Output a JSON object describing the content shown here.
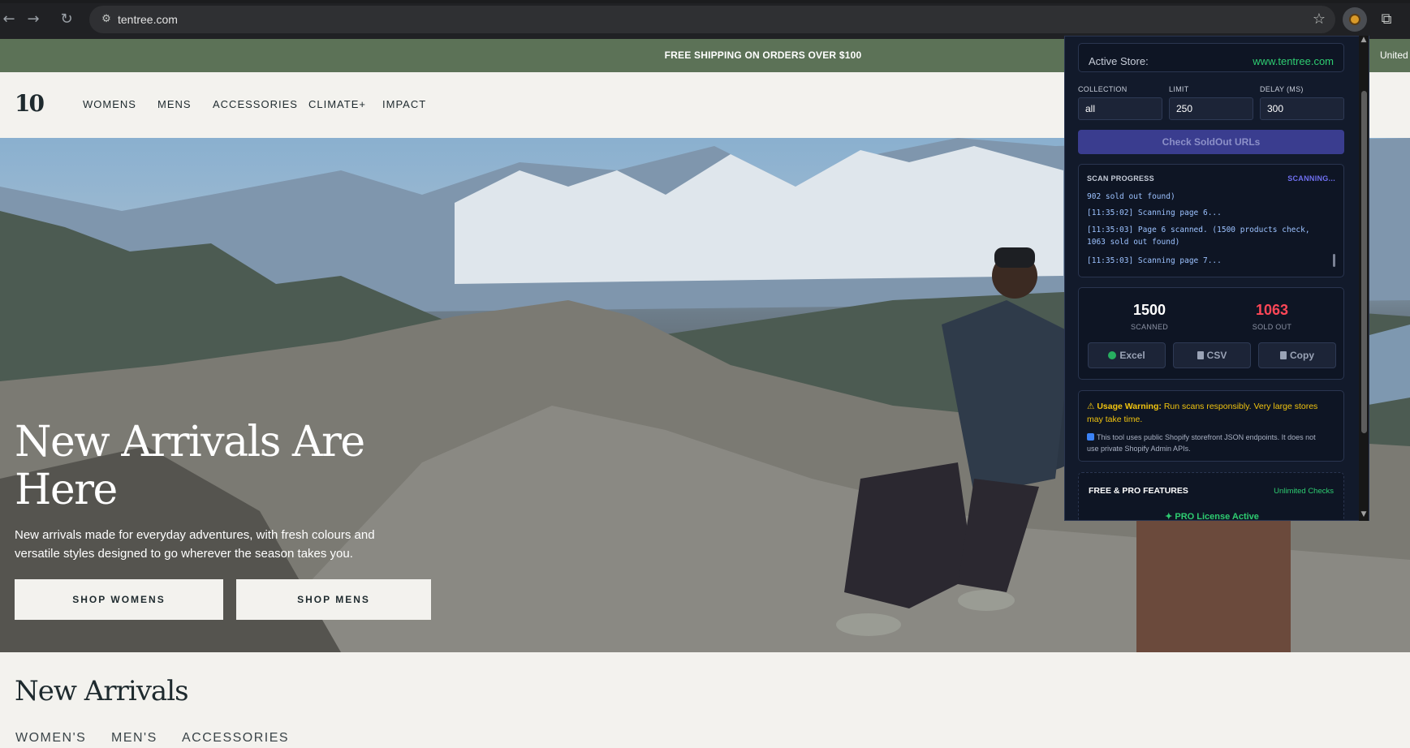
{
  "browser": {
    "url": "tentree.com"
  },
  "site": {
    "announcement": "FREE SHIPPING ON ORDERS OVER $100",
    "country": "United",
    "logo": "10",
    "nav": [
      "WOMENS",
      "MENS",
      "ACCESSORIES",
      "CLIMATE+",
      "IMPACT"
    ],
    "hero": {
      "title": "New Arrivals Are Here",
      "subtitle": "New arrivals made for everyday adventures, with fresh colours and versatile styles designed to go wherever the season takes you.",
      "buttons": [
        "SHOP WOMENS",
        "SHOP MENS"
      ]
    },
    "section": {
      "title": "New Arrivals",
      "tabs": [
        "WOMEN'S",
        "MEN'S",
        "ACCESSORIES"
      ]
    }
  },
  "extension": {
    "active_store_label": "Active Store:",
    "active_store": "www.tentree.com",
    "fields": [
      {
        "label": "COLLECTION",
        "value": "all"
      },
      {
        "label": "LIMIT",
        "value": "250"
      },
      {
        "label": "DELAY (MS)",
        "value": "300"
      }
    ],
    "check_button": "Check SoldOut URLs",
    "log": {
      "title": "SCAN PROGRESS",
      "status": "SCANNING...",
      "lines": [
        "902 sold out found)",
        "[11:35:02] Scanning page 6...",
        "[11:35:03] Page 6 scanned. (1500 products check, 1063 sold out found)",
        "[11:35:03] Scanning page 7..."
      ]
    },
    "stats": {
      "scanned": "1500",
      "scanned_label": "SCANNED",
      "sold_out": "1063",
      "sold_out_label": "SOLD OUT"
    },
    "exports": [
      "Excel",
      "CSV",
      "Copy"
    ],
    "warning": {
      "lead": "Usage Warning:",
      "text": "Run scans responsibly. Very large stores may take time.",
      "note": "This tool uses public Shopify storefront JSON endpoints. It does not use private Shopify Admin APIs."
    },
    "features": {
      "title": "FREE & PRO FEATURES",
      "badge": "Unlimited Checks",
      "pro": "PRO License Active"
    }
  },
  "colors": {
    "announcement_bg": "#5c7257",
    "popup_bg": "#121a2b",
    "accent_green": "#2ecc71",
    "sold_out_red": "#ff4757",
    "button_purple": "#3a3d8f",
    "warning_yellow": "#f1c40f"
  }
}
